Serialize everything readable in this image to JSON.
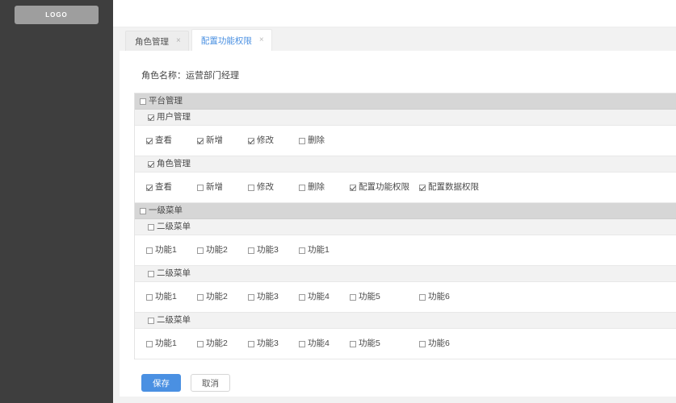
{
  "sidebar": {
    "logo_label": "LOGO"
  },
  "tabs": [
    {
      "label": "角色管理",
      "close_icon": "×",
      "active": false
    },
    {
      "label": "配置功能权限",
      "close_icon": "×",
      "active": true
    }
  ],
  "content": {
    "role_name_label": "角色名称：",
    "role_name_value": "运营部门经理"
  },
  "permissions": {
    "groups": [
      {
        "label": "平台管理",
        "checked": false,
        "modules": [
          {
            "label": "用户管理",
            "checked": true,
            "actions": [
              {
                "label": "查看",
                "checked": true
              },
              {
                "label": "新增",
                "checked": true
              },
              {
                "label": "修改",
                "checked": true
              },
              {
                "label": "删除",
                "checked": false
              }
            ]
          },
          {
            "label": "角色管理",
            "checked": true,
            "actions": [
              {
                "label": "查看",
                "checked": true
              },
              {
                "label": "新增",
                "checked": false
              },
              {
                "label": "修改",
                "checked": false
              },
              {
                "label": "删除",
                "checked": false
              },
              {
                "label": "配置功能权限",
                "checked": true
              },
              {
                "label": "配置数据权限",
                "checked": true
              }
            ]
          }
        ]
      },
      {
        "label": "一级菜单",
        "checked": false,
        "modules": [
          {
            "label": "二级菜单",
            "checked": false,
            "actions": [
              {
                "label": "功能1",
                "checked": false
              },
              {
                "label": "功能2",
                "checked": false
              },
              {
                "label": "功能3",
                "checked": false
              },
              {
                "label": "功能1",
                "checked": false
              }
            ]
          },
          {
            "label": "二级菜单",
            "checked": false,
            "actions": [
              {
                "label": "功能1",
                "checked": false
              },
              {
                "label": "功能2",
                "checked": false
              },
              {
                "label": "功能3",
                "checked": false
              },
              {
                "label": "功能4",
                "checked": false
              },
              {
                "label": "功能5",
                "checked": false
              },
              {
                "label": "功能6",
                "checked": false
              }
            ]
          },
          {
            "label": "二级菜单",
            "checked": false,
            "actions": [
              {
                "label": "功能1",
                "checked": false
              },
              {
                "label": "功能2",
                "checked": false
              },
              {
                "label": "功能3",
                "checked": false
              },
              {
                "label": "功能4",
                "checked": false
              },
              {
                "label": "功能5",
                "checked": false
              },
              {
                "label": "功能6",
                "checked": false
              }
            ]
          }
        ]
      }
    ],
    "column_offsets": [
      14,
      77,
      140,
      203,
      266,
      352
    ]
  },
  "footer": {
    "save_label": "保存",
    "cancel_label": "取消"
  },
  "colors": {
    "sidebar_bg": "#3e3e3e",
    "accent": "#4a90e2",
    "group_row_bg": "#d6d6d6",
    "module_row_bg": "#f2f2f2"
  }
}
